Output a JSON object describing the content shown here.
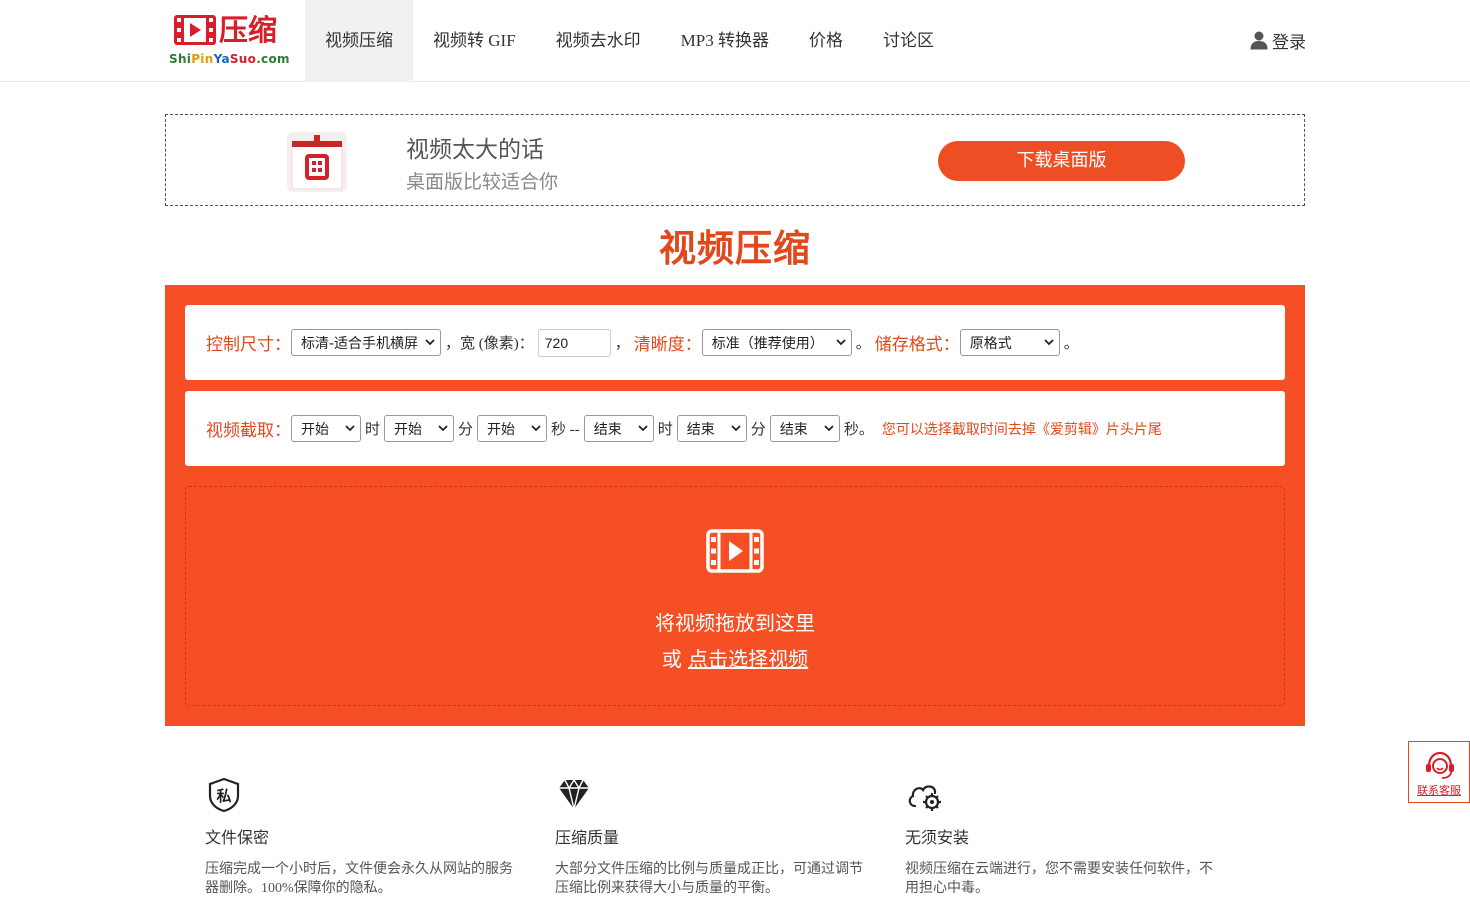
{
  "header": {
    "logo_text": "压缩",
    "logo_domain": [
      "Shi",
      "Pin",
      "Ya",
      "Suo",
      ".com"
    ],
    "nav": [
      {
        "label": "视频压缩",
        "active": true
      },
      {
        "label": "视频转 GIF",
        "active": false
      },
      {
        "label": "视频去水印",
        "active": false
      },
      {
        "label": "MP3 转换器",
        "active": false
      },
      {
        "label": "价格",
        "active": false
      },
      {
        "label": "讨论区",
        "active": false
      }
    ],
    "login_label": "登录"
  },
  "banner": {
    "line1": "视频太大的话",
    "line2": "桌面版比较适合你",
    "button_label": "下载桌面版"
  },
  "page_title": "视频压缩",
  "settings": {
    "size_label": "控制尺寸：",
    "size_value": "标清-适合手机横屏",
    "width_label": "，宽 (像素)：",
    "width_value": "720",
    "clarity_label": "清晰度：",
    "clarity_sep": "，",
    "clarity_value": "标准（推荐使用）",
    "format_sep": "。",
    "format_label": "储存格式：",
    "format_value": "原格式",
    "end_sep": "。"
  },
  "clip": {
    "label": "视频截取：",
    "start_hour": "开始",
    "unit_hour": "时",
    "start_min": "开始",
    "unit_min": "分",
    "start_sec": "开始",
    "unit_sec_dash": "秒 --",
    "end_hour": "结束",
    "end_min": "结束",
    "end_sec": "结束",
    "unit_sec_end": "秒。",
    "hint": "您可以选择截取时间去掉《爱剪辑》片头片尾"
  },
  "dropzone": {
    "line1": "将视频拖放到这里",
    "or": "或 ",
    "link": "点击选择视频"
  },
  "features": [
    {
      "icon": "shield-private-icon",
      "glyph": "私",
      "title": "文件保密",
      "desc": "压缩完成一个小时后，文件便会永久从网站的服务器删除。100%保障你的隐私。"
    },
    {
      "icon": "diamond-icon",
      "title": "压缩质量",
      "desc": "大部分文件压缩的比例与质量成正比，可通过调节压缩比例来获得大小与质量的平衡。"
    },
    {
      "icon": "cloud-gear-icon",
      "title": "无须安装",
      "desc": "视频压缩在云端进行，您不需要安装任何软件，不用担心中毒。"
    }
  ],
  "service": {
    "label": "联系客服"
  },
  "colors": {
    "accent": "#f54f23",
    "brand_red": "#d81e2a",
    "title": "#e3471c"
  }
}
